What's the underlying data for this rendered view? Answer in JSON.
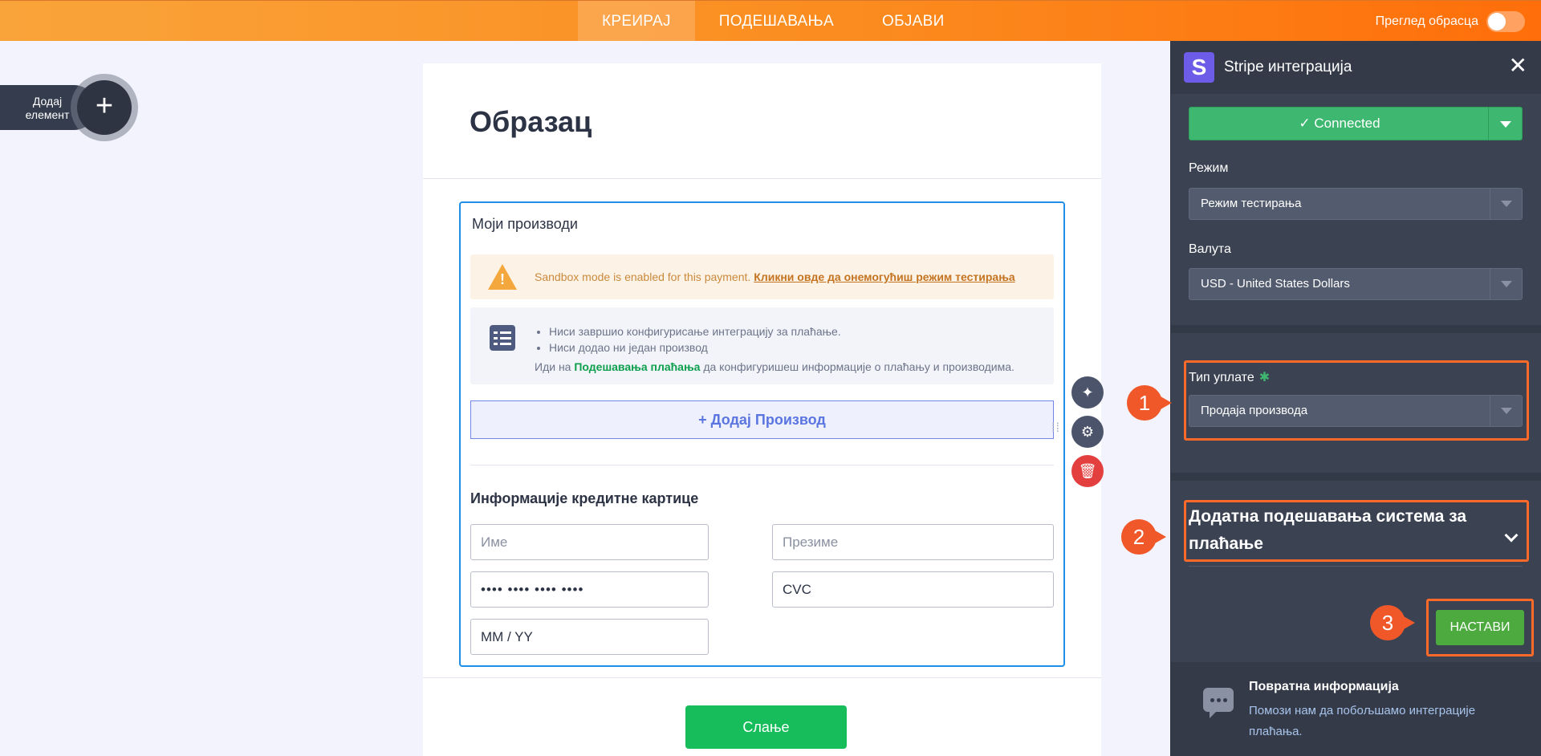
{
  "nav": {
    "tabs": [
      {
        "label": "КРЕИРАЈ",
        "active": true
      },
      {
        "label": "ПОДЕШАВАЊА",
        "active": false
      },
      {
        "label": "ОБЈАВИ",
        "active": false
      }
    ],
    "preview_label": "Преглед обрасца"
  },
  "add_element": {
    "line1": "Додај",
    "line2": "елемент",
    "icon": "plus-icon"
  },
  "form": {
    "title": "Образац",
    "products_title": "Моји производи",
    "sandbox_text": "Sandbox mode is enabled for this payment.",
    "sandbox_link": "Кликни овде да онемогућиш режим тестирања",
    "info_items": [
      "Ниси завршио конфигурисање интеграцију за плаћање.",
      "Ниси додао ни један производ"
    ],
    "info_go_prefix": "Иди на",
    "info_go_link": "Подешавања плаћања",
    "info_go_suffix": "да конфигуришеш информације о плаћању и производима.",
    "add_product": "+ Додај Производ",
    "cc_title": "Информације кредитне картице",
    "first_name_ph": "Име",
    "last_name_ph": "Презиме",
    "card_number": "•••• •••• •••• ••••",
    "cvc": "CVC",
    "expiry": "MM / YY",
    "submit": "Слање"
  },
  "panel": {
    "title": "Stripe интеграција",
    "logo_letter": "S",
    "connected_label": "✓ Connected",
    "mode_label": "Режим",
    "mode_value": "Режим тестирања",
    "currency_label": "Валута",
    "currency_value": "USD - United States Dollars",
    "payment_type_label": "Тип уплате",
    "required_star": "✱",
    "payment_type_value": "Продаја производа",
    "extra_settings": "Додатна подешавања система за плаћање",
    "continue": "НАСТАВИ",
    "feedback_title": "Повратна информација",
    "feedback_text": "Помози нам да побољшамо интеграције плаћања."
  },
  "annotations": [
    "1",
    "2",
    "3"
  ],
  "colors": {
    "accent": "#ff6a2b",
    "connected": "#3eb870",
    "continue": "#4caa3e",
    "submit": "#18bd5b"
  }
}
